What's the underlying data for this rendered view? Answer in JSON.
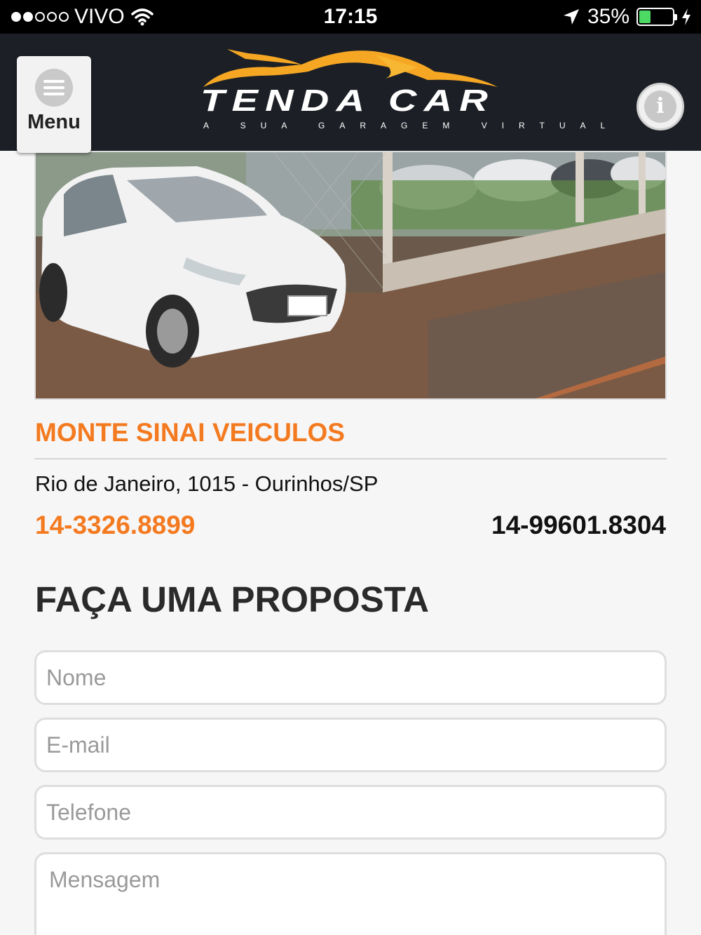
{
  "status_bar": {
    "carrier": "VIVO",
    "signal_bars_filled": 2,
    "signal_bars_total": 5,
    "time": "17:15",
    "battery_percent": "35%",
    "battery_level": 0.35
  },
  "header": {
    "menu_label": "Menu",
    "logo_text": "TENDA CAR",
    "tagline": "A SUA GARAGEM VIRTUAL",
    "brand_color": "#f5a623"
  },
  "dealer": {
    "name": "MONTE SINAI VEICULOS",
    "address": "Rio de Janeiro, 1015 - Ourinhos/SP",
    "phone_landline": "14-3326.8899",
    "phone_mobile": "14-99601.8304"
  },
  "form": {
    "title": "FAÇA UMA PROPOSTA",
    "name_placeholder": "Nome",
    "email_placeholder": "E-mail",
    "phone_placeholder": "Telefone",
    "message_placeholder": "Mensagem"
  },
  "colors": {
    "accent": "#f47a20",
    "header_bg": "#1c2026"
  }
}
